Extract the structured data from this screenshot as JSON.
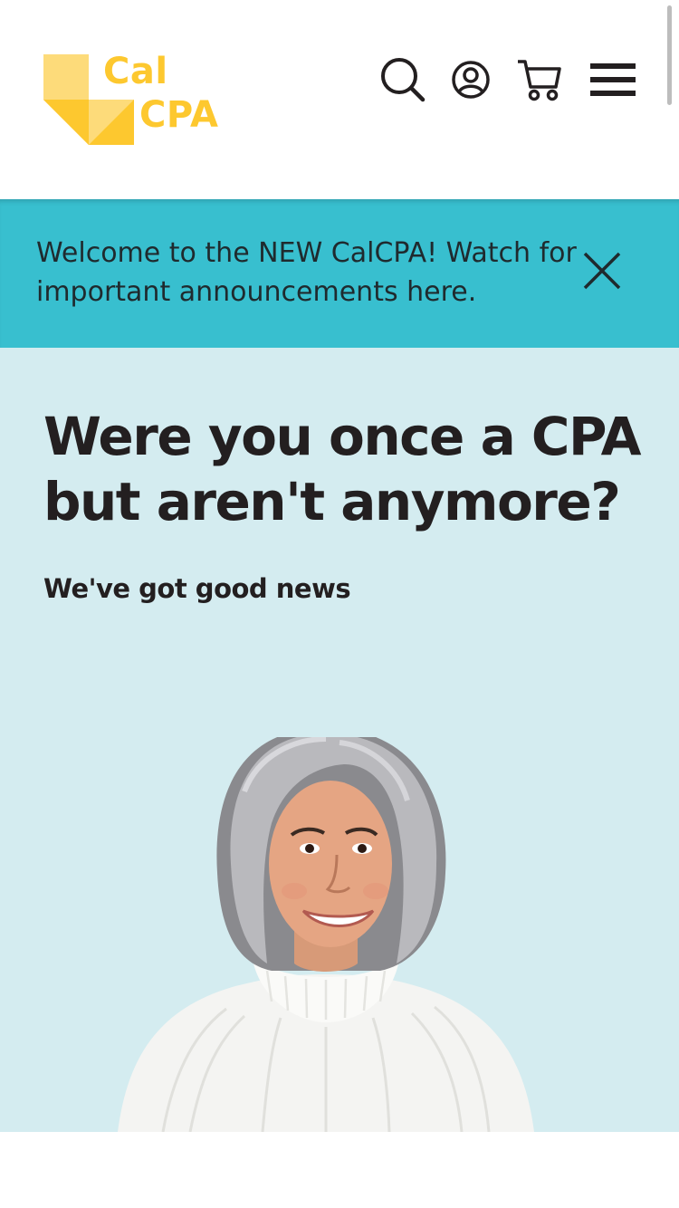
{
  "brand": {
    "logo_line1": "Cal",
    "logo_line2": "CPA",
    "logo_color": "#fdc82f",
    "logo_color_light": "#fddb7a"
  },
  "header": {
    "icons": [
      "search-icon",
      "account-icon",
      "cart-icon",
      "menu-icon"
    ]
  },
  "announcement": {
    "text": "Welcome to the NEW CalCPA! Watch for important announcements here.",
    "close_icon": "close-icon",
    "background": "#38bfcf"
  },
  "hero": {
    "title": "Were you once a CPA but aren't anymore?",
    "subtitle": "We've got good news",
    "background": "#d4ecf0",
    "image": "smiling-woman-white-sweater"
  }
}
